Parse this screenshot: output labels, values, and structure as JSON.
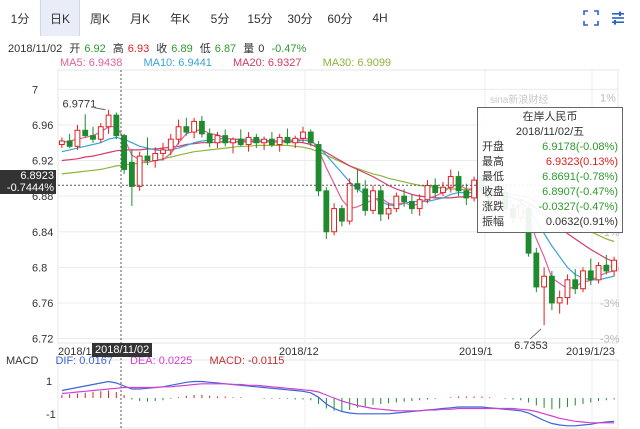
{
  "toolbar": {
    "tabs": [
      "1分",
      "日K",
      "周K",
      "月K",
      "年K",
      "5分",
      "15分",
      "30分",
      "60分",
      "4H"
    ],
    "active_tab": 1,
    "icons": [
      "expand-icon",
      "settings-icon"
    ]
  },
  "info": {
    "date": "2018/11/02",
    "open_label": "开",
    "open": "6.92",
    "high_label": "高",
    "high": "6.93",
    "close_label": "收",
    "close": "6.89",
    "low_label": "低",
    "low": "6.87",
    "vol_label": "量",
    "vol": "0",
    "change": "-0.47%"
  },
  "ma": {
    "ma5": "MA5: 6.9438",
    "ma10": "MA10: 6.9441",
    "ma20": "MA20: 6.9327",
    "ma30": "MA30: 6.9099",
    "colors": {
      "ma5": "#e0609a",
      "ma10": "#3aa3d6",
      "ma20": "#d8386a",
      "ma30": "#8fb43a"
    }
  },
  "cursor": {
    "price": "6.8923",
    "pct": "-0.7444%",
    "date": "2018/11/02"
  },
  "watermark": "sina新浪财经",
  "tooltip": {
    "title": "在岸人民币",
    "date": "2018/11/02/五",
    "rows": [
      {
        "label": "开盘",
        "value": "6.9178(-0.08%)",
        "color": "#2e9a2e"
      },
      {
        "label": "最高",
        "value": "6.9323(0.13%)",
        "color": "#e02020"
      },
      {
        "label": "最低",
        "value": "6.8691(-0.78%)",
        "color": "#2e9a2e"
      },
      {
        "label": "收盘",
        "value": "6.8907(-0.47%)",
        "color": "#2e9a2e"
      },
      {
        "label": "涨跌",
        "value": "-0.0327(-0.47%)",
        "color": "#2e9a2e"
      },
      {
        "label": "振幅",
        "value": "0.0632(0.91%)",
        "color": "#333333"
      }
    ]
  },
  "macd": {
    "label": "MACD",
    "dif": "DIF: 0.0167",
    "dea": "DEA: 0.0225",
    "macd": "MACD: -0.0115",
    "colors": {
      "dif": "#3a64d8",
      "dea": "#d040d0",
      "macd": "#c03030"
    }
  },
  "chart_data": {
    "type": "candlestick",
    "y_ticks": [
      "7",
      "6.96",
      "6.92",
      "6.88",
      "6.84",
      "6.8",
      "6.76",
      "6.72"
    ],
    "pct_ticks": [
      "1%",
      "-1%",
      "-2%",
      "-3%",
      "-3%"
    ],
    "x_ticks": [
      "2018/11",
      "2018/12",
      "2019/1",
      "2019/1/23"
    ],
    "macd_ticks": [
      "1",
      "-1"
    ],
    "ylim": [
      6.715,
      7.015
    ],
    "annotations": [
      {
        "text": "6.9771",
        "value": 6.9771
      },
      {
        "text": "6.7353",
        "value": 6.7353
      }
    ],
    "candles": [
      [
        6.938,
        6.946,
        6.934,
        6.942
      ],
      [
        6.942,
        6.95,
        6.934,
        6.936
      ],
      [
        6.936,
        6.96,
        6.932,
        6.954
      ],
      [
        6.954,
        6.972,
        6.946,
        6.948
      ],
      [
        6.948,
        6.958,
        6.94,
        6.944
      ],
      [
        6.944,
        6.962,
        6.94,
        6.958
      ],
      [
        6.958,
        6.977,
        6.95,
        6.971
      ],
      [
        6.971,
        6.974,
        6.944,
        6.948
      ],
      [
        6.948,
        6.95,
        6.905,
        6.91
      ],
      [
        6.918,
        6.932,
        6.869,
        6.891
      ],
      [
        6.891,
        6.93,
        6.886,
        6.925
      ],
      [
        6.925,
        6.946,
        6.915,
        6.92
      ],
      [
        6.92,
        6.935,
        6.912,
        6.928
      ],
      [
        6.928,
        6.94,
        6.92,
        6.932
      ],
      [
        6.932,
        6.95,
        6.926,
        6.944
      ],
      [
        6.944,
        6.966,
        6.938,
        6.958
      ],
      [
        6.958,
        6.968,
        6.948,
        6.952
      ],
      [
        6.952,
        6.968,
        6.945,
        6.964
      ],
      [
        6.964,
        6.97,
        6.946,
        6.95
      ],
      [
        6.95,
        6.956,
        6.935,
        6.94
      ],
      [
        6.94,
        6.952,
        6.934,
        6.948
      ],
      [
        6.948,
        6.955,
        6.936,
        6.94
      ],
      [
        6.94,
        6.946,
        6.928,
        6.944
      ],
      [
        6.944,
        6.955,
        6.936,
        6.938
      ],
      [
        6.938,
        6.952,
        6.93,
        6.946
      ],
      [
        6.946,
        6.95,
        6.934,
        6.94
      ],
      [
        6.94,
        6.947,
        6.932,
        6.944
      ],
      [
        6.944,
        6.952,
        6.935,
        6.938
      ],
      [
        6.938,
        6.95,
        6.93,
        6.946
      ],
      [
        6.946,
        6.956,
        6.938,
        6.94
      ],
      [
        6.94,
        6.948,
        6.934,
        6.945
      ],
      [
        6.945,
        6.958,
        6.94,
        6.952
      ],
      [
        6.952,
        6.955,
        6.936,
        6.94
      ],
      [
        6.938,
        6.942,
        6.88,
        6.886
      ],
      [
        6.886,
        6.89,
        6.832,
        6.84
      ],
      [
        6.84,
        6.872,
        6.836,
        6.866
      ],
      [
        6.866,
        6.87,
        6.846,
        6.852
      ],
      [
        6.852,
        6.9,
        6.848,
        6.894
      ],
      [
        6.894,
        6.91,
        6.884,
        6.888
      ],
      [
        6.888,
        6.898,
        6.858,
        6.864
      ],
      [
        6.864,
        6.892,
        6.86,
        6.886
      ],
      [
        6.886,
        6.892,
        6.852,
        6.86
      ],
      [
        6.86,
        6.872,
        6.854,
        6.866
      ],
      [
        6.866,
        6.884,
        6.862,
        6.88
      ],
      [
        6.88,
        6.888,
        6.868,
        6.874
      ],
      [
        6.874,
        6.882,
        6.86,
        6.866
      ],
      [
        6.866,
        6.882,
        6.858,
        6.876
      ],
      [
        6.876,
        6.898,
        6.872,
        6.892
      ],
      [
        6.892,
        6.9,
        6.878,
        6.884
      ],
      [
        6.884,
        6.896,
        6.88,
        6.89
      ],
      [
        6.89,
        6.91,
        6.884,
        6.902
      ],
      [
        6.902,
        6.908,
        6.88,
        6.886
      ],
      [
        6.886,
        6.894,
        6.87,
        6.878
      ],
      [
        6.878,
        6.902,
        6.874,
        6.898
      ],
      [
        6.898,
        6.904,
        6.88,
        6.886
      ],
      [
        6.886,
        6.892,
        6.866,
        6.872
      ],
      [
        6.872,
        6.89,
        6.866,
        6.884
      ],
      [
        6.884,
        6.892,
        6.86,
        6.866
      ],
      [
        6.866,
        6.87,
        6.85,
        6.856
      ],
      [
        6.856,
        6.876,
        6.852,
        6.87
      ],
      [
        6.866,
        6.87,
        6.812,
        6.816
      ],
      [
        6.816,
        6.822,
        6.772,
        6.778
      ],
      [
        6.778,
        6.8,
        6.735,
        6.79
      ],
      [
        6.79,
        6.796,
        6.752,
        6.76
      ],
      [
        6.76,
        6.774,
        6.748,
        6.766
      ],
      [
        6.766,
        6.792,
        6.758,
        6.786
      ],
      [
        6.786,
        6.798,
        6.77,
        6.776
      ],
      [
        6.776,
        6.8,
        6.772,
        6.796
      ],
      [
        6.796,
        6.81,
        6.78,
        6.786
      ],
      [
        6.786,
        6.806,
        6.782,
        6.802
      ],
      [
        6.802,
        6.814,
        6.792,
        6.796
      ],
      [
        6.796,
        6.812,
        6.79,
        6.808
      ]
    ],
    "ma5": [
      6.94,
      6.942,
      6.944,
      6.946,
      6.948,
      6.952,
      6.958,
      6.958,
      6.945,
      6.926,
      6.921,
      6.918,
      6.92,
      6.921,
      6.928,
      6.94,
      6.95,
      6.953,
      6.955,
      6.95,
      6.949,
      6.945,
      6.944,
      6.943,
      6.942,
      6.942,
      6.941,
      6.942,
      6.942,
      6.943,
      6.943,
      6.945,
      6.944,
      6.932,
      6.912,
      6.894,
      6.876,
      6.866,
      6.868,
      6.872,
      6.876,
      6.878,
      6.872,
      6.87,
      6.873,
      6.869,
      6.872,
      6.877,
      6.88,
      6.884,
      6.891,
      6.893,
      6.888,
      6.888,
      6.89,
      6.884,
      6.88,
      6.878,
      6.87,
      6.866,
      6.856,
      6.832,
      6.812,
      6.788,
      6.782,
      6.776,
      6.778,
      6.784,
      6.785,
      6.79,
      6.794,
      6.796
    ],
    "ma10": [
      6.93,
      6.932,
      6.934,
      6.936,
      6.938,
      6.94,
      6.944,
      6.946,
      6.944,
      6.94,
      6.936,
      6.934,
      6.932,
      6.931,
      6.932,
      6.934,
      6.937,
      6.94,
      6.942,
      6.943,
      6.944,
      6.945,
      6.944,
      6.944,
      6.944,
      6.943,
      6.943,
      6.942,
      6.942,
      6.942,
      6.942,
      6.943,
      6.942,
      6.936,
      6.926,
      6.916,
      6.906,
      6.896,
      6.888,
      6.882,
      6.878,
      6.874,
      6.87,
      6.869,
      6.872,
      6.874,
      6.874,
      6.874,
      6.876,
      6.878,
      6.882,
      6.884,
      6.884,
      6.884,
      6.886,
      6.886,
      6.884,
      6.882,
      6.878,
      6.874,
      6.866,
      6.852,
      6.838,
      6.824,
      6.812,
      6.8,
      6.792,
      6.788,
      6.786,
      6.786,
      6.788,
      6.79
    ],
    "ma20": [
      6.92,
      6.921,
      6.922,
      6.924,
      6.925,
      6.927,
      6.929,
      6.931,
      6.932,
      6.932,
      6.932,
      6.933,
      6.933,
      6.934,
      6.935,
      6.936,
      6.938,
      6.939,
      6.94,
      6.94,
      6.941,
      6.941,
      6.941,
      6.941,
      6.941,
      6.941,
      6.941,
      6.941,
      6.941,
      6.941,
      6.941,
      6.94,
      6.938,
      6.934,
      6.929,
      6.924,
      6.919,
      6.914,
      6.91,
      6.906,
      6.902,
      6.897,
      6.892,
      6.888,
      6.885,
      6.882,
      6.88,
      6.879,
      6.878,
      6.878,
      6.878,
      6.879,
      6.879,
      6.88,
      6.881,
      6.881,
      6.881,
      6.88,
      6.878,
      6.876,
      6.872,
      6.866,
      6.859,
      6.852,
      6.845,
      6.838,
      6.832,
      6.826,
      6.82,
      6.815,
      6.81,
      6.806
    ],
    "ma30": [
      6.905,
      6.906,
      6.907,
      6.908,
      6.909,
      6.91,
      6.912,
      6.914,
      6.915,
      6.916,
      6.917,
      6.918,
      6.92,
      6.922,
      6.924,
      6.926,
      6.928,
      6.93,
      6.931,
      6.932,
      6.933,
      6.934,
      6.935,
      6.936,
      6.936,
      6.937,
      6.937,
      6.937,
      6.937,
      6.937,
      6.936,
      6.935,
      6.933,
      6.93,
      6.926,
      6.922,
      6.918,
      6.914,
      6.911,
      6.908,
      6.905,
      6.903,
      6.9,
      6.898,
      6.896,
      6.894,
      6.892,
      6.891,
      6.89,
      6.889,
      6.888,
      6.888,
      6.887,
      6.887,
      6.886,
      6.885,
      6.884,
      6.883,
      6.882,
      6.88,
      6.878,
      6.874,
      6.869,
      6.864,
      6.859,
      6.854,
      6.849,
      6.844,
      6.84,
      6.836,
      6.832,
      6.829
    ],
    "macd_hist": [
      0.004,
      0.005,
      0.006,
      0.007,
      0.008,
      0.009,
      0.01,
      0.008,
      0.004,
      -0.002,
      -0.004,
      -0.005,
      -0.004,
      -0.003,
      -0.001,
      0.001,
      0.003,
      0.004,
      0.004,
      0.003,
      0.002,
      0.002,
      0.001,
      0.001,
      0.0,
      0.0,
      -0.001,
      -0.001,
      -0.001,
      -0.001,
      -0.002,
      -0.002,
      -0.003,
      -0.008,
      -0.014,
      -0.017,
      -0.018,
      -0.016,
      -0.013,
      -0.011,
      -0.009,
      -0.008,
      -0.007,
      -0.006,
      -0.005,
      -0.004,
      -0.003,
      -0.002,
      -0.001,
      0.0,
      0.001,
      0.002,
      0.002,
      0.002,
      0.002,
      0.001,
      0.0,
      -0.001,
      -0.002,
      -0.003,
      -0.006,
      -0.01,
      -0.013,
      -0.015,
      -0.014,
      -0.012,
      -0.01,
      -0.008,
      -0.006,
      -0.004,
      -0.003,
      -0.002
    ],
    "dif": [
      0.01,
      0.012,
      0.014,
      0.016,
      0.018,
      0.02,
      0.022,
      0.02,
      0.016,
      0.012,
      0.012,
      0.013,
      0.014,
      0.015,
      0.017,
      0.019,
      0.021,
      0.022,
      0.022,
      0.021,
      0.02,
      0.019,
      0.018,
      0.017,
      0.016,
      0.015,
      0.014,
      0.013,
      0.012,
      0.011,
      0.01,
      0.009,
      0.007,
      0.001,
      -0.008,
      -0.014,
      -0.018,
      -0.02,
      -0.021,
      -0.021,
      -0.021,
      -0.021,
      -0.021,
      -0.02,
      -0.019,
      -0.018,
      -0.017,
      -0.016,
      -0.015,
      -0.014,
      -0.013,
      -0.012,
      -0.012,
      -0.012,
      -0.012,
      -0.013,
      -0.014,
      -0.015,
      -0.016,
      -0.017,
      -0.02,
      -0.025,
      -0.03,
      -0.034,
      -0.036,
      -0.037,
      -0.037,
      -0.036,
      -0.035,
      -0.033,
      -0.032,
      -0.031
    ],
    "dea": [
      0.006,
      0.007,
      0.008,
      0.009,
      0.01,
      0.011,
      0.012,
      0.013,
      0.014,
      0.014,
      0.014,
      0.014,
      0.014,
      0.015,
      0.015,
      0.016,
      0.017,
      0.018,
      0.019,
      0.019,
      0.019,
      0.019,
      0.018,
      0.018,
      0.017,
      0.017,
      0.016,
      0.015,
      0.014,
      0.013,
      0.012,
      0.011,
      0.01,
      0.008,
      0.004,
      0.0,
      -0.004,
      -0.007,
      -0.01,
      -0.012,
      -0.014,
      -0.015,
      -0.016,
      -0.017,
      -0.017,
      -0.017,
      -0.017,
      -0.016,
      -0.016,
      -0.015,
      -0.015,
      -0.014,
      -0.014,
      -0.014,
      -0.014,
      -0.014,
      -0.014,
      -0.014,
      -0.014,
      -0.015,
      -0.016,
      -0.018,
      -0.021,
      -0.024,
      -0.027,
      -0.029,
      -0.031,
      -0.032,
      -0.033,
      -0.033,
      -0.033,
      -0.033
    ]
  }
}
